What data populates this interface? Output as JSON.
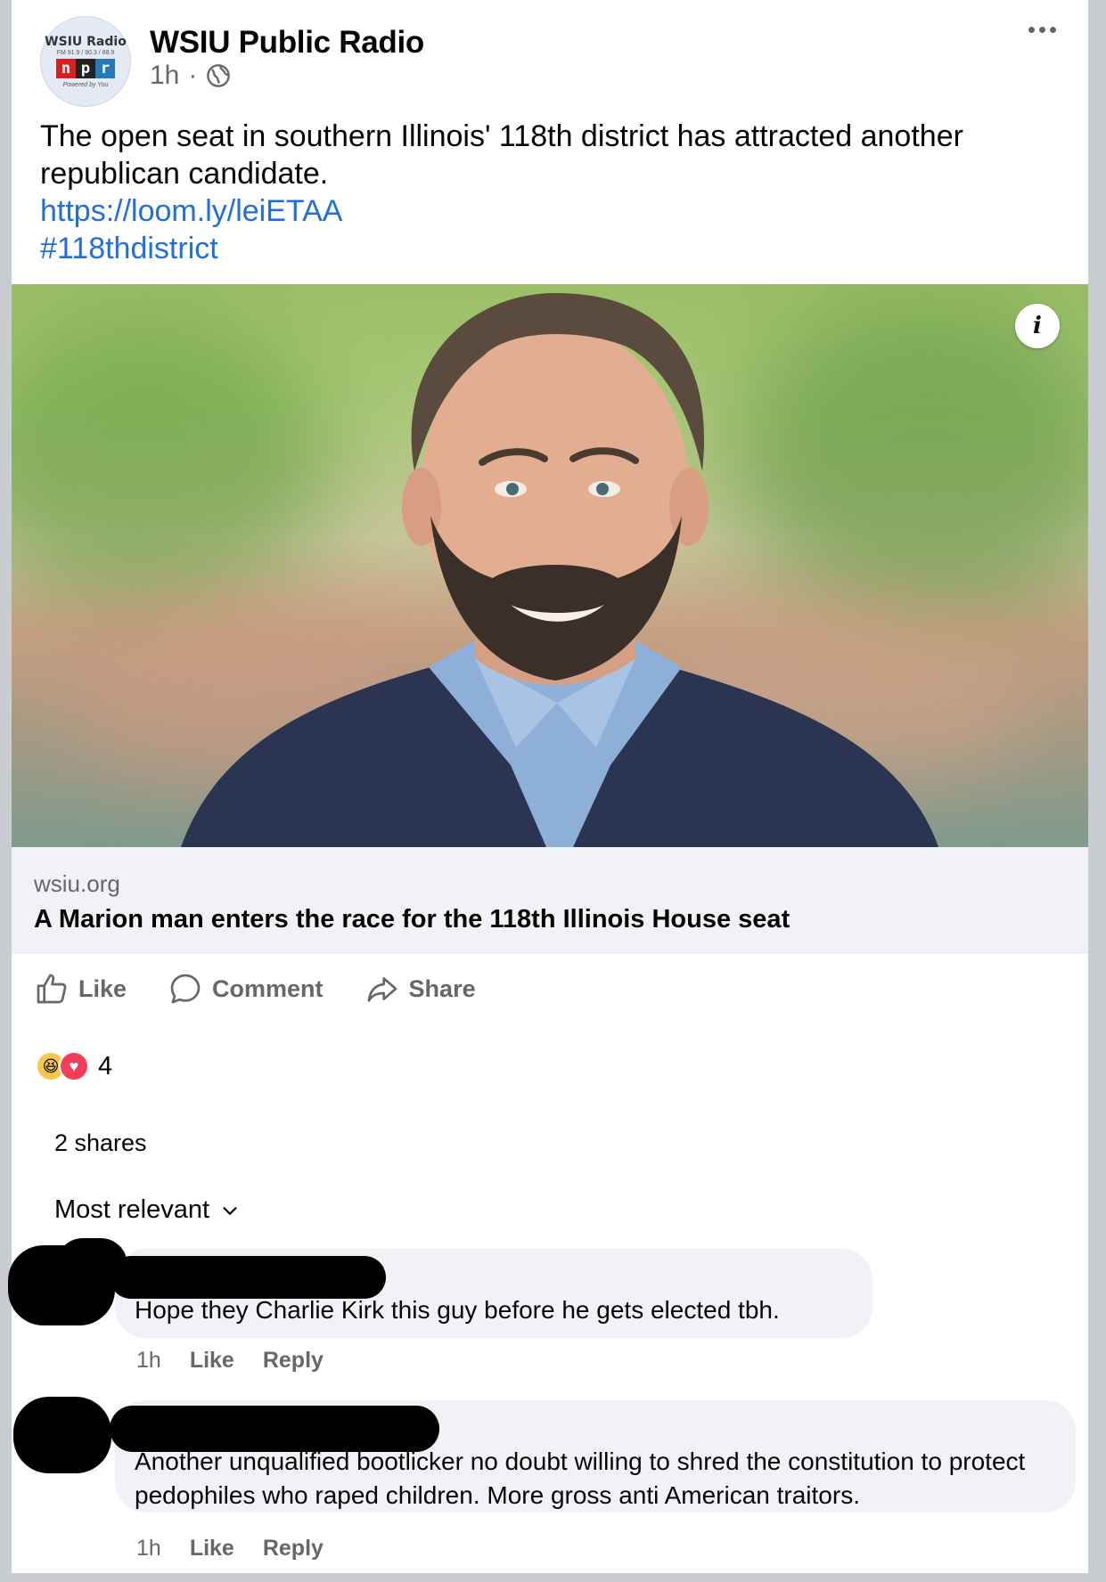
{
  "post": {
    "page_name": "WSIU Public Radio",
    "time": "1h",
    "separator": "·",
    "avatar": {
      "title": "WSIU Radio",
      "freq": "FM 91.9 / 90.3 / 88.9",
      "npr": [
        "n",
        "p",
        "r"
      ],
      "tagline": "Powered by You"
    },
    "text": "The open seat in southern Illinois' 118th district has attracted another republican candidate.",
    "link": "https://loom.ly/leiETAA",
    "hashtag": "#118thdistrict"
  },
  "link_preview": {
    "domain": "wsiu.org",
    "title": "A Marion man enters the race for the 118th Illinois House seat",
    "info_glyph": "i"
  },
  "actions": {
    "like": "Like",
    "comment": "Comment",
    "share": "Share"
  },
  "reactions": {
    "count": "4",
    "types": [
      "haha",
      "love"
    ]
  },
  "shares": "2 shares",
  "sort_label": "Most relevant",
  "comments": [
    {
      "text": "Hope they Charlie Kirk this guy before he gets elected tbh.",
      "time": "1h",
      "like": "Like",
      "reply": "Reply"
    },
    {
      "text": "Another unqualified bootlicker no doubt willing to shred the constitution to protect pedophiles who raped children. More gross anti American traitors.",
      "time": "1h",
      "like": "Like",
      "reply": "Reply"
    }
  ],
  "colors": {
    "link_blue": "#216fdb",
    "secondary_text": "#65676b",
    "bubble_bg": "#f0f2f5"
  }
}
